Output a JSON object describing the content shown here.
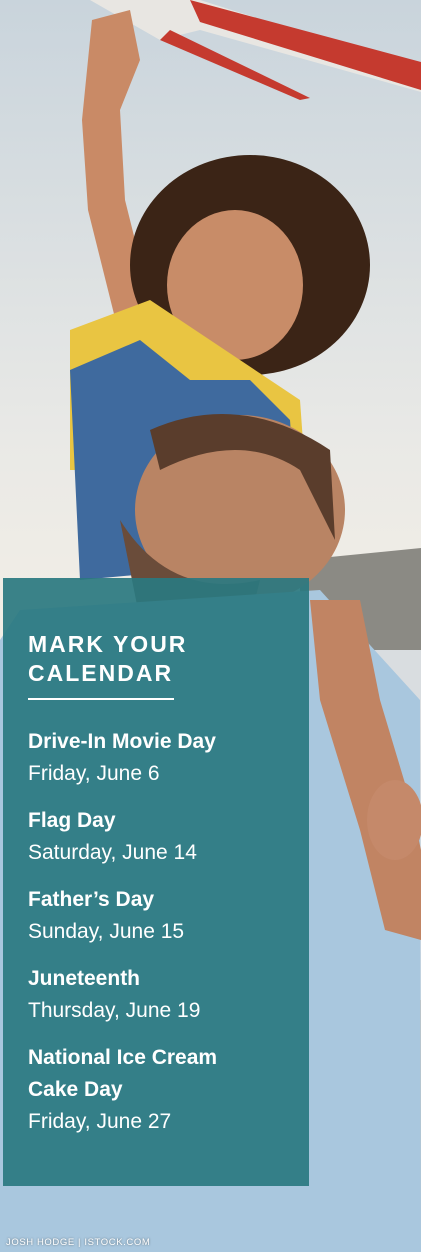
{
  "calendar": {
    "heading_line1": "MARK YOUR",
    "heading_line2": "CALENDAR",
    "events": [
      {
        "name": "Drive-In Movie Day",
        "date": "Friday, June 6"
      },
      {
        "name": "Flag Day",
        "date": "Saturday, June 14"
      },
      {
        "name": "Father’s Day",
        "date": "Sunday, June 15"
      },
      {
        "name": "Juneteenth",
        "date": "Thursday, June 19"
      },
      {
        "name": "National Ice Cream Cake Day",
        "date": "Friday, June 27"
      }
    ]
  },
  "photo_credit": "JOSH HODGE | ISTOCK.COM",
  "colors": {
    "panel": "#2a7880",
    "text": "#ffffff"
  }
}
